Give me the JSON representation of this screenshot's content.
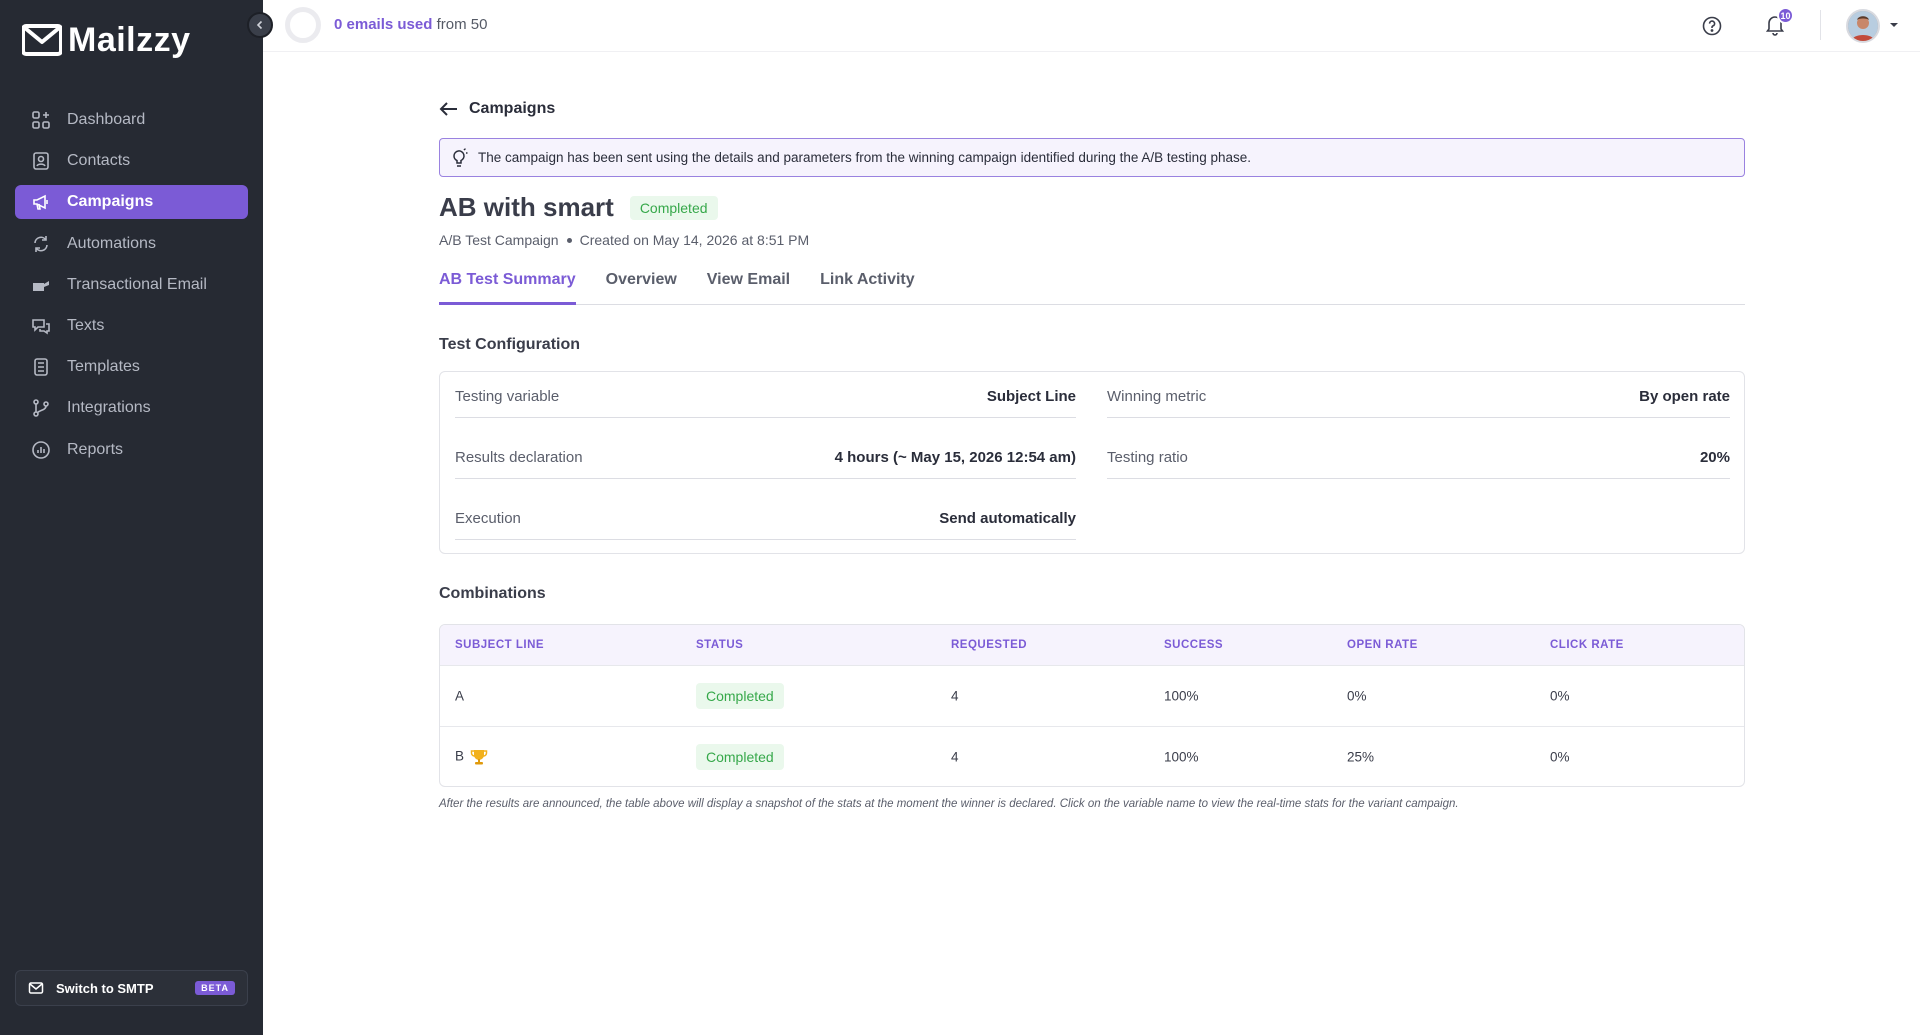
{
  "brand": {
    "name": "Mailzzy",
    "accent": "#7b5bd6",
    "sidebar_bg": "#262a33"
  },
  "sidebar": {
    "items": [
      {
        "label": "Dashboard",
        "icon": "dashboard-icon"
      },
      {
        "label": "Contacts",
        "icon": "contacts-icon"
      },
      {
        "label": "Campaigns",
        "icon": "megaphone-icon",
        "active": true
      },
      {
        "label": "Automations",
        "icon": "automations-icon"
      },
      {
        "label": "Transactional Email",
        "icon": "transactional-icon"
      },
      {
        "label": "Texts",
        "icon": "texts-icon"
      },
      {
        "label": "Templates",
        "icon": "templates-icon"
      },
      {
        "label": "Integrations",
        "icon": "integrations-icon"
      },
      {
        "label": "Reports",
        "icon": "reports-icon"
      }
    ],
    "smtp": {
      "label": "Switch to SMTP",
      "badge": "BETA"
    }
  },
  "topbar": {
    "usage_strong": "0 emails used",
    "usage_rest": "from 50",
    "notifications_count": "10"
  },
  "main": {
    "back_label": "Campaigns",
    "notice": "The campaign has been sent using the details and parameters from the winning campaign identified during the A/B testing phase.",
    "title": "AB with smart",
    "status": "Completed",
    "campaign_type": "A/B Test Campaign",
    "created": "Created on May 14, 2026 at 8:51 PM",
    "tabs": [
      "AB Test Summary",
      "Overview",
      "View Email",
      "Link Activity"
    ],
    "config_title": "Test Configuration",
    "config": {
      "testing_variable": {
        "label": "Testing variable",
        "value": "Subject Line"
      },
      "winning_metric": {
        "label": "Winning metric",
        "value": "By open rate"
      },
      "results_declaration": {
        "label": "Results declaration",
        "value": "4 hours (~ May 15, 2026 12:54 am)"
      },
      "testing_ratio": {
        "label": "Testing ratio",
        "value": "20%"
      },
      "execution": {
        "label": "Execution",
        "value": "Send automatically"
      }
    },
    "combinations_title": "Combinations",
    "table": {
      "headers": [
        "SUBJECT LINE",
        "STATUS",
        "REQUESTED",
        "SUCCESS",
        "OPEN RATE",
        "CLICK RATE"
      ],
      "rows": [
        {
          "subject": "A",
          "status": "Completed",
          "requested": "4",
          "success": "100%",
          "open_rate": "0%",
          "click_rate": "0%",
          "winner": false
        },
        {
          "subject": "B",
          "status": "Completed",
          "requested": "4",
          "success": "100%",
          "open_rate": "25%",
          "click_rate": "0%",
          "winner": true
        }
      ]
    },
    "footnote": "After the results are announced, the table above will display a snapshot of the stats at the moment the winner is declared. Click on the variable name to view the real-time stats for the variant campaign."
  }
}
